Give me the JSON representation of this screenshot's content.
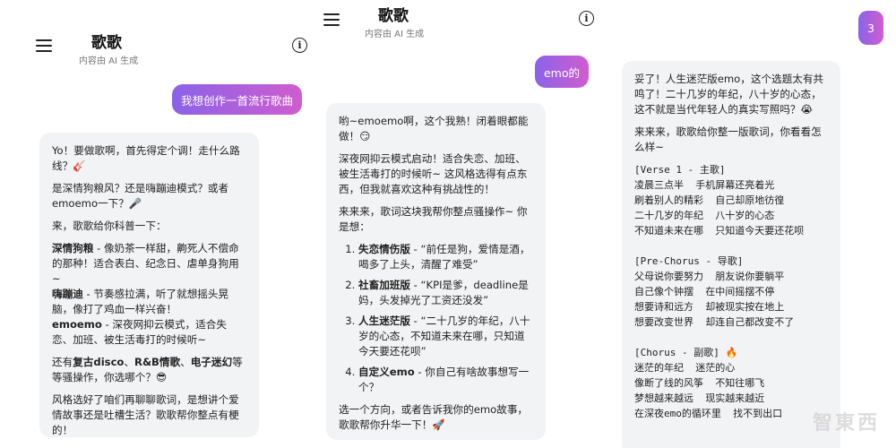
{
  "panel1": {
    "title": "歌歌",
    "subtitle": "内容由 AI 生成",
    "user_message": "我想创作一首流行歌曲",
    "reply": {
      "p1": "Yo！要做歌啊，首先得定个调！走什么路线？🎸",
      "p2": "是深情狗粮风？还是嗨蹦迪模式？或者emoemo一下？🎤",
      "p3": "来，歌歌给你科普一下：",
      "styles": [
        {
          "name": "深情狗粮",
          "desc": " - 像奶茶一样甜，齁死人不偿命的那种！适合表白、纪念日、虐单身狗用~"
        },
        {
          "name": "嗨蹦迪",
          "desc": " - 节奏感拉满，听了就想摇头晃脑，像打了鸡血一样兴奋！"
        },
        {
          "name": "emoemo",
          "desc": " - 深夜网抑云模式，适合失恋、加班、被生活毒打的时候听~"
        }
      ],
      "more_prefix": "还有",
      "more_items": [
        "复古disco",
        "R&B情歌",
        "电子迷幻"
      ],
      "more_sep1": "、",
      "more_sep2": "、",
      "more_suffix": "等等骚操作，你选哪个？😎",
      "p5": "风格选好了咱们再聊聊歌词，是想讲个爱情故事还是吐槽生活？歌歌帮你整点有梗的！"
    }
  },
  "panel2": {
    "title": "歌歌",
    "subtitle": "内容由 AI 生成",
    "user_message": "emo的",
    "reply": {
      "p1": "哟~emoemo啊，这个我熟！闭着眼都能做！😏",
      "p2": "深夜网抑云模式启动！适合失恋、加班、被生活毒打的时候听~ 这风格选得有点东西，但我就喜欢这种有挑战性的！",
      "p3": "来来来，歌词这块我帮你整点骚操作~ 你是想：",
      "options": [
        {
          "name": "失恋情伤版",
          "desc": " - “前任是狗，爱情是酒，喝多了上头，清醒了难受”"
        },
        {
          "name": "社畜加班版",
          "desc": " - “KPI是爹，deadline是妈，头发掉光了工资还没发”"
        },
        {
          "name": "人生迷茫版",
          "desc": " - “二十几岁的年纪，八十岁的心态，不知道未来在哪，只知道今天要还花呗”"
        },
        {
          "name": "自定义emo",
          "desc": " - 你自己有啥故事想写一个？"
        }
      ],
      "p4": "选一个方向，或者告诉我你的emo故事，歌歌帮你升华一下！🚀"
    }
  },
  "panel3": {
    "user_message": "3",
    "reply": {
      "p1": "妥了！人生迷茫版emo，这个选题太有共鸣了！二十几岁的年纪，八十岁的心态，这不就是当代年轻人的真实写照吗？😭",
      "p2": "来来来，歌歌给你整一版歌词，你看看怎么样~",
      "lyrics": [
        "[Verse 1 - 主歌]",
        "凌晨三点半  手机屏幕还亮着光",
        "刷着别人的精彩  自己却原地彷徨",
        "二十几岁的年纪  八十岁的心态",
        "不知道未来在哪  只知道今天要还花呗",
        "",
        "[Pre-Chorus - 导歌]",
        "父母说你要努力  朋友说你要躺平",
        "自己像个钟摆  在中间摇摆不停",
        "想要诗和远方  却被现实按在地上",
        "想要改变世界  却连自己都改变不了",
        "",
        "[Chorus - 副歌] 🔥",
        "迷茫的年纪  迷茫的心",
        "像断了线的风筝  不知往哪飞",
        "梦想越来越远  现实越来越近",
        "在深夜emo的循环里  找不到出口"
      ]
    }
  },
  "watermark": "智東西"
}
